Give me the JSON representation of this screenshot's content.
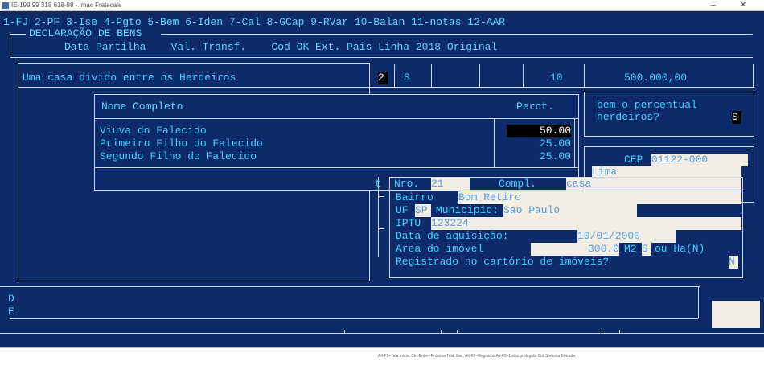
{
  "window": {
    "title": "IE-199 99 318 618-98 - Imac Fratecale",
    "minimize": "–",
    "close": "✕"
  },
  "menu": "1-FJ 2-PF 3-Ise 4-Pgto 5-Bem 6-Iden 7-Cal 8-GCap 9-RVar 10-Balan 11-notas 12-AAR",
  "section_title": "DECLARAÇÃO DE BENS",
  "columns": "Data Partilha    Val. Transf.    Cod OK Ext. Pais Linha 2018 Original",
  "row": {
    "description": "Uma casa divido entre os Herdeiros",
    "cod": "2",
    "ok": "S",
    "linha": "10",
    "valor": "500.000,00"
  },
  "heirs": {
    "header_name": "Nome Completo",
    "header_perc": "Perct.",
    "rows": [
      {
        "name": "Viuva do Falecido",
        "perc": "50.00"
      },
      {
        "name": "Primeiro Filho do Falecido",
        "perc": "25.00"
      },
      {
        "name": "Segundo Filho do Falecido",
        "perc": "25.00"
      }
    ]
  },
  "question": {
    "line1": "bem o percentual",
    "line2": "herdeiros?",
    "answer": "S"
  },
  "address": {
    "cep_label": "CEP",
    "cep_value": "01122-000",
    "logradouro": "Lima",
    "nro_label": "Nro.",
    "nro_value": "21",
    "compl_label": "Compl.",
    "compl_value": "casa",
    "bairro_label": "Bairro",
    "bairro_value": "Bom Retiro",
    "uf_label": "UF",
    "uf_value": "SP",
    "municipio_label": "Municipio:",
    "municipio_value": "Sao Paulo",
    "iptu_label": "IPTU",
    "iptu_value": "123224",
    "data_label": "Data de aquisição:",
    "data_value": "10/01/2000",
    "area_label": "Area do imóvel",
    "area_value": "300.0",
    "m2_label": "M2",
    "m2_choice": "S",
    "ha_label": "ou Ha(N)",
    "registrado_label": "Registrado no cartório de imóveis?",
    "registrado_value": "N"
  },
  "bottom": {
    "d": "D",
    "e": "E"
  },
  "statusbar": "Alt-F1=Tela Inicio, Ctrl-Enter=Proxima Tela, Esc, Alt-F2=Registros Alt-F3=Linha protegida Ctrl-Sinfonia Entrada"
}
